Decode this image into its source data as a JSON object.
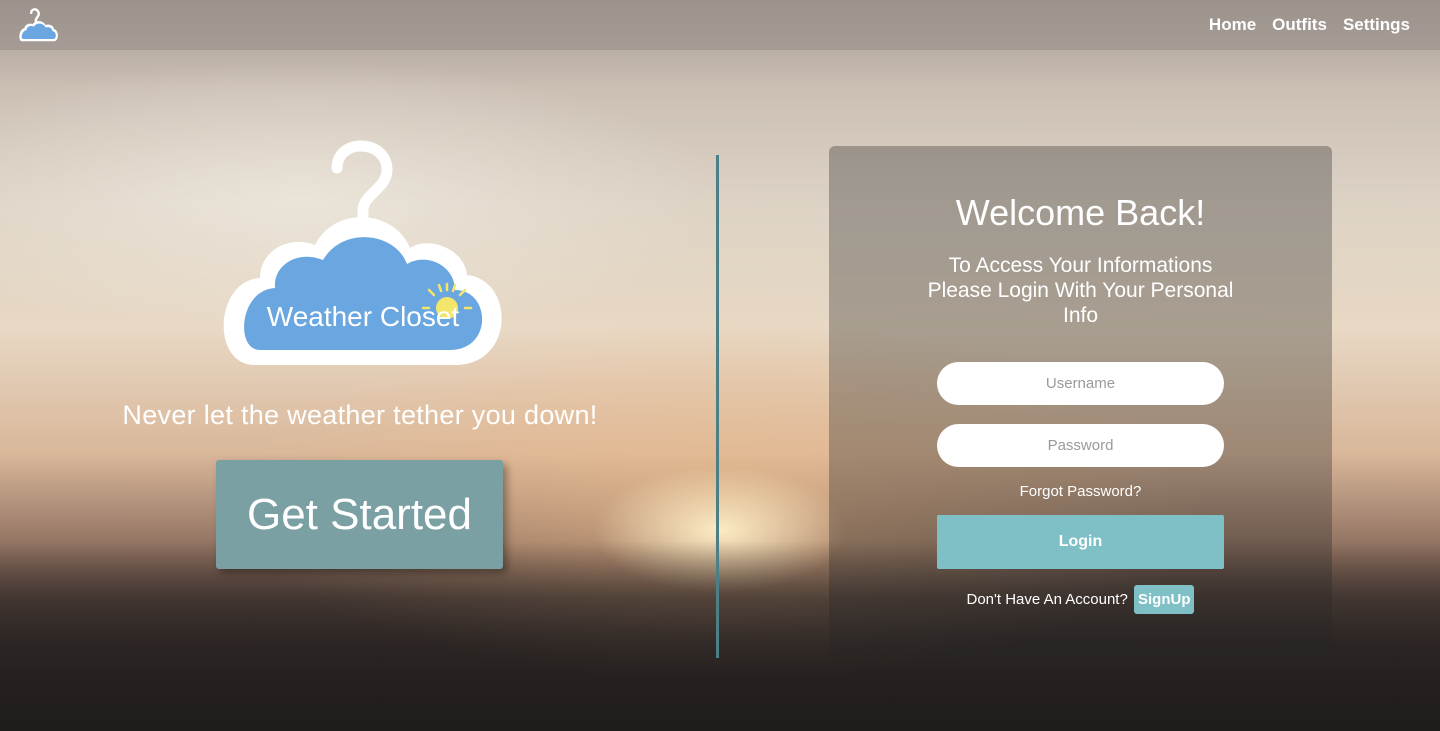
{
  "brand": {
    "logo_text": "Weather Closet",
    "logo_color": "#6aa6e0",
    "sun_color": "#f3e66b"
  },
  "nav": {
    "items": [
      {
        "label": "Home"
      },
      {
        "label": "Outfits"
      },
      {
        "label": "Settings"
      }
    ]
  },
  "hero": {
    "tagline": "Never let the weather tether you down!",
    "cta_label": "Get Started"
  },
  "login": {
    "title": "Welcome Back!",
    "subtitle": "To Access Your Informations Please Login With Your Personal Info",
    "username_placeholder": "Username",
    "password_placeholder": "Password",
    "forgot_label": "Forgot Password?",
    "login_label": "Login",
    "no_account_text": "Don't Have An Account?",
    "signup_label": "SignUp"
  },
  "colors": {
    "accent": "#7fbfc6",
    "cta": "#7aa0a4",
    "divider": "#4d7f86"
  }
}
